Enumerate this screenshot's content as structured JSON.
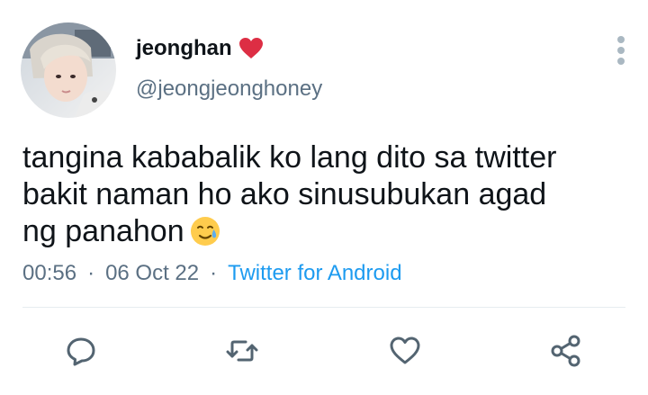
{
  "author": {
    "display_name": "jeonghan",
    "handle": "@jeongjeonghoney",
    "name_emoji": "red-heart"
  },
  "tweet": {
    "text_lines": [
      "tangina kababalik ko lang dito sa twitter",
      "bakit naman ho ako sinusubukan agad",
      "ng panahon"
    ],
    "trailing_emoji": "smiling-face-with-tear"
  },
  "meta": {
    "time": "00:56",
    "separator": "·",
    "date": "06 Oct 22",
    "source": "Twitter for Android"
  },
  "actions": {
    "icons": [
      "reply-icon",
      "retweet-icon",
      "like-icon",
      "share-icon"
    ]
  },
  "colors": {
    "text": "#0f1419",
    "secondary": "#5b7083",
    "link": "#1d9bf0",
    "icon": "#536471",
    "divider": "#e6ecf0",
    "heart": "#e0245e"
  }
}
